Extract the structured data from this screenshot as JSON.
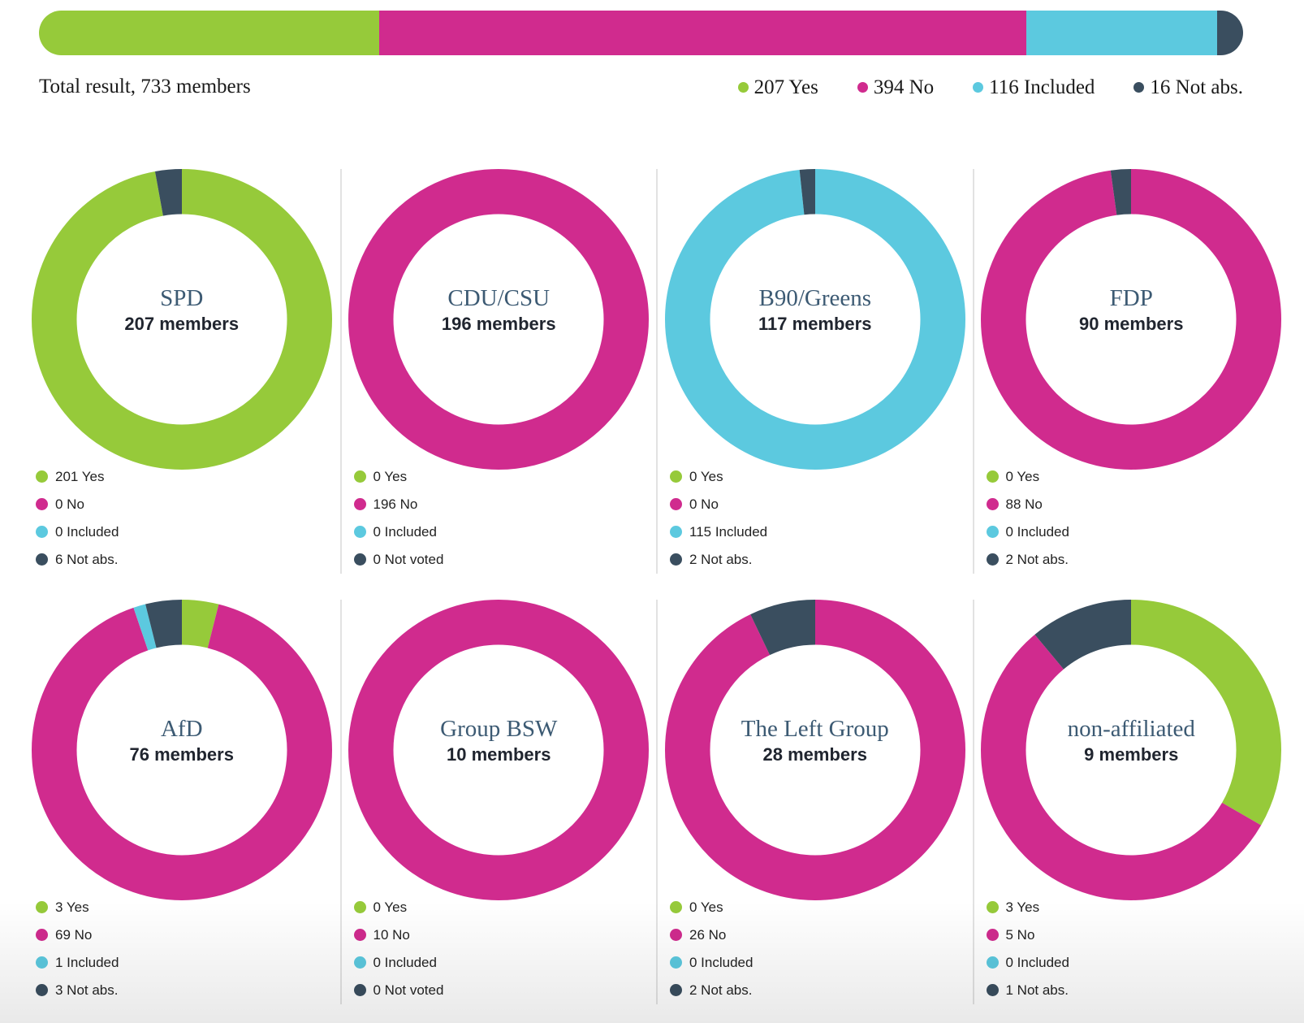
{
  "colors": {
    "yes": "#96ca3a",
    "no": "#d02b8e",
    "included": "#5cc9df",
    "not_abs": "#3a4e5f",
    "donut_title": "#3c5a73",
    "divider": "#e2e2e2"
  },
  "chart_data": {
    "type": "donut-grid",
    "unit": "members",
    "totals": {
      "type": "stacked-bar",
      "title": "Total result, 733 members",
      "total_members": 733,
      "segments": [
        {
          "key": "yes",
          "value": 207,
          "label": "207 Yes"
        },
        {
          "key": "no",
          "value": 394,
          "label": "394 No"
        },
        {
          "key": "included",
          "value": 116,
          "label": "116 Included"
        },
        {
          "key": "not_abs",
          "value": 16,
          "label": "16 Not abs."
        }
      ]
    },
    "groups": [
      {
        "name": "SPD",
        "subtitle": "207 members",
        "members": 207,
        "segments": [
          {
            "key": "yes",
            "value": 201,
            "label": "201 Yes"
          },
          {
            "key": "no",
            "value": 0,
            "label": "0 No"
          },
          {
            "key": "included",
            "value": 0,
            "label": "0 Included"
          },
          {
            "key": "not_abs",
            "value": 6,
            "label": "6 Not abs."
          }
        ]
      },
      {
        "name": "CDU/CSU",
        "subtitle": "196 members",
        "members": 196,
        "segments": [
          {
            "key": "yes",
            "value": 0,
            "label": "0 Yes"
          },
          {
            "key": "no",
            "value": 196,
            "label": "196 No"
          },
          {
            "key": "included",
            "value": 0,
            "label": "0 Included"
          },
          {
            "key": "not_abs",
            "value": 0,
            "label": "0 Not voted"
          }
        ]
      },
      {
        "name": "B90/Greens",
        "subtitle": "117 members",
        "members": 117,
        "segments": [
          {
            "key": "yes",
            "value": 0,
            "label": "0 Yes"
          },
          {
            "key": "no",
            "value": 0,
            "label": "0 No"
          },
          {
            "key": "included",
            "value": 115,
            "label": "115 Included"
          },
          {
            "key": "not_abs",
            "value": 2,
            "label": "2 Not abs."
          }
        ]
      },
      {
        "name": "FDP",
        "subtitle": "90 members",
        "members": 90,
        "segments": [
          {
            "key": "yes",
            "value": 0,
            "label": "0 Yes"
          },
          {
            "key": "no",
            "value": 88,
            "label": "88 No"
          },
          {
            "key": "included",
            "value": 0,
            "label": "0 Included"
          },
          {
            "key": "not_abs",
            "value": 2,
            "label": "2 Not abs."
          }
        ]
      },
      {
        "name": "AfD",
        "subtitle": "76 members",
        "members": 76,
        "segments": [
          {
            "key": "yes",
            "value": 3,
            "label": "3 Yes"
          },
          {
            "key": "no",
            "value": 69,
            "label": "69 No"
          },
          {
            "key": "included",
            "value": 1,
            "label": "1 Included"
          },
          {
            "key": "not_abs",
            "value": 3,
            "label": "3 Not abs."
          }
        ]
      },
      {
        "name": "Group BSW",
        "subtitle": "10 members",
        "members": 10,
        "segments": [
          {
            "key": "yes",
            "value": 0,
            "label": "0 Yes"
          },
          {
            "key": "no",
            "value": 10,
            "label": "10 No"
          },
          {
            "key": "included",
            "value": 0,
            "label": "0 Included"
          },
          {
            "key": "not_abs",
            "value": 0,
            "label": "0 Not voted"
          }
        ]
      },
      {
        "name": "The Left Group",
        "subtitle": "28 members",
        "members": 28,
        "segments": [
          {
            "key": "yes",
            "value": 0,
            "label": "0 Yes"
          },
          {
            "key": "no",
            "value": 26,
            "label": "26 No"
          },
          {
            "key": "included",
            "value": 0,
            "label": "0 Included"
          },
          {
            "key": "not_abs",
            "value": 2,
            "label": "2 Not abs."
          }
        ]
      },
      {
        "name": "non-affiliated",
        "subtitle": "9 members",
        "members": 9,
        "segments": [
          {
            "key": "yes",
            "value": 3,
            "label": "3 Yes"
          },
          {
            "key": "no",
            "value": 5,
            "label": "5 No"
          },
          {
            "key": "included",
            "value": 0,
            "label": "0 Included"
          },
          {
            "key": "not_abs",
            "value": 1,
            "label": "1 Not abs."
          }
        ]
      }
    ]
  }
}
